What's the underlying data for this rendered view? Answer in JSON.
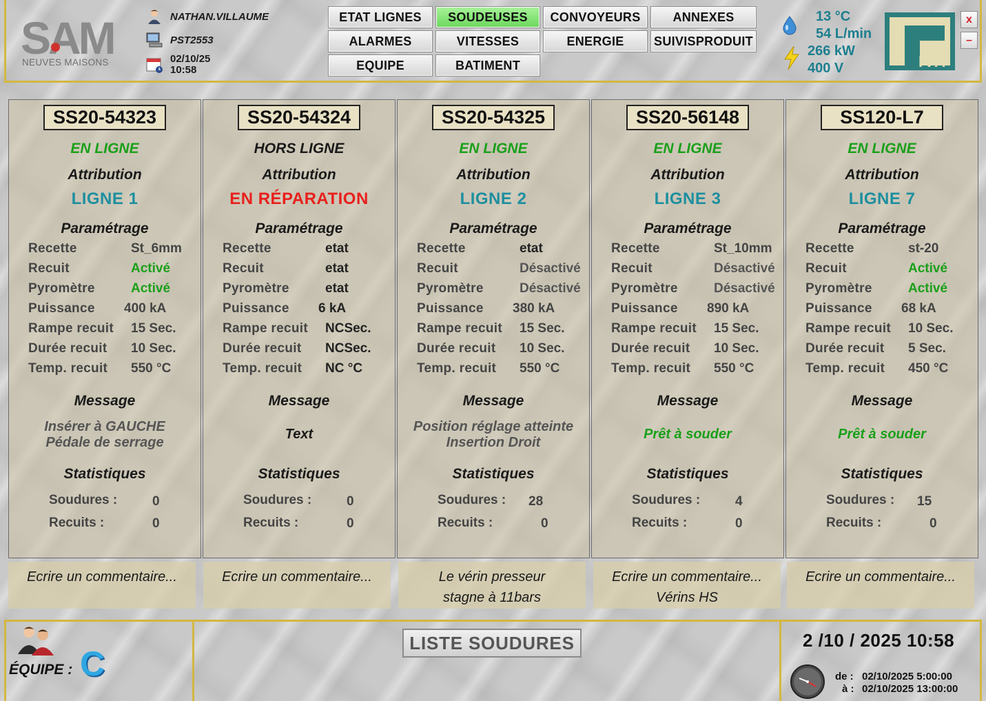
{
  "header": {
    "logo_text": "SAM",
    "logo_sub": "NEUVES MAISONS",
    "user": "NATHAN.VILLAUME",
    "station": "PST2553",
    "date": "02/10/25",
    "time": "10:58",
    "nav": [
      {
        "label": "ETAT LIGNES"
      },
      {
        "label": "SOUDEUSES",
        "active": true
      },
      {
        "label": "CONVOYEURS"
      },
      {
        "label": "ANNEXES"
      },
      {
        "label": "ALARMES"
      },
      {
        "label": "VITESSES"
      },
      {
        "label": "ENERGIE"
      },
      {
        "label": "SUIVISPRODUIT"
      },
      {
        "label": "EQUIPE"
      },
      {
        "label": "BATIMENT"
      }
    ],
    "stats": {
      "temperature": "13 °C",
      "flow": "54 L/min",
      "power": "266 kW",
      "voltage": "400 V"
    },
    "brand": "IVA",
    "close_label": "x",
    "minimize_label": "–"
  },
  "panels": [
    {
      "id": "SS20-54323",
      "status": "EN LIGNE",
      "status_color": "#1aa01a",
      "attribution_label": "Attribution",
      "line": "LIGNE 1",
      "line_color": "#1e8f9f",
      "param_label": "Paramétrage",
      "params": [
        {
          "label": "Recette",
          "value": "St_6mm",
          "color": "#444"
        },
        {
          "label": "Recuit",
          "value": "Activé",
          "color": "#1aa01a"
        },
        {
          "label": "Pyromètre",
          "value": "Activé",
          "color": "#1aa01a"
        },
        {
          "label": "Puissance",
          "value": "400 kA",
          "color": "#444"
        },
        {
          "label": "Rampe recuit",
          "value": "15 Sec.",
          "color": "#444"
        },
        {
          "label": "Durée recuit",
          "value": "10 Sec.",
          "color": "#444"
        },
        {
          "label": "Temp. recuit",
          "value": "550 °C",
          "color": "#444"
        }
      ],
      "message_label": "Message",
      "message": [
        "Insérer à GAUCHE",
        "Pédale de serrage"
      ],
      "message_color": "#555",
      "stats_label": "Statistiques",
      "soudures_label": "Soudures :",
      "soudures": "0",
      "recuits_label": "Recuits :",
      "recuits": "0",
      "comment": [
        "Ecrire un commentaire..."
      ]
    },
    {
      "id": "SS20-54324",
      "status": "HORS LIGNE",
      "status_color": "#1a1a1a",
      "attribution_label": "Attribution",
      "line": "EN RÉPARATION",
      "line_color": "#e8201c",
      "param_label": "Paramétrage",
      "params": [
        {
          "label": "Recette",
          "value": "etat",
          "color": "#222"
        },
        {
          "label": "Recuit",
          "value": "etat",
          "color": "#222"
        },
        {
          "label": "Pyromètre",
          "value": "etat",
          "color": "#222"
        },
        {
          "label": "Puissance",
          "value": "6 kA",
          "color": "#222"
        },
        {
          "label": "Rampe recuit",
          "value": "NCSec.",
          "color": "#222"
        },
        {
          "label": "Durée recuit",
          "value": "NCSec.",
          "color": "#222"
        },
        {
          "label": "Temp. recuit",
          "value": "NC  °C",
          "color": "#222"
        }
      ],
      "message_label": "Message",
      "message": [
        "Text"
      ],
      "message_color": "#1a1a1a",
      "stats_label": "Statistiques",
      "soudures_label": "Soudures :",
      "soudures": "0",
      "recuits_label": "Recuits :",
      "recuits": "0",
      "comment": [
        "Ecrire un commentaire..."
      ]
    },
    {
      "id": "SS20-54325",
      "status": "EN LIGNE",
      "status_color": "#1aa01a",
      "attribution_label": "Attribution",
      "line": "LIGNE 2",
      "line_color": "#1e8f9f",
      "param_label": "Paramétrage",
      "params": [
        {
          "label": "Recette",
          "value": "etat",
          "color": "#222"
        },
        {
          "label": "Recuit",
          "value": "Désactivé",
          "color": "#555"
        },
        {
          "label": "Pyromètre",
          "value": "Désactivé",
          "color": "#555"
        },
        {
          "label": "Puissance",
          "value": "380 kA",
          "color": "#444"
        },
        {
          "label": "Rampe recuit",
          "value": "15 Sec.",
          "color": "#444"
        },
        {
          "label": "Durée recuit",
          "value": "10 Sec.",
          "color": "#444"
        },
        {
          "label": "Temp. recuit",
          "value": "550 °C",
          "color": "#444"
        }
      ],
      "message_label": "Message",
      "message": [
        "Position réglage atteinte",
        "Insertion Droit"
      ],
      "message_color": "#555",
      "stats_label": "Statistiques",
      "soudures_label": "Soudures :",
      "soudures": "28",
      "recuits_label": "Recuits :",
      "recuits": "0",
      "comment": [
        "Le vérin presseur",
        "stagne à 11bars"
      ]
    },
    {
      "id": "SS20-56148",
      "status": "EN LIGNE",
      "status_color": "#1aa01a",
      "attribution_label": "Attribution",
      "line": "LIGNE 3",
      "line_color": "#1e8f9f",
      "param_label": "Paramétrage",
      "params": [
        {
          "label": "Recette",
          "value": "St_10mm",
          "color": "#444"
        },
        {
          "label": "Recuit",
          "value": "Désactivé",
          "color": "#555"
        },
        {
          "label": "Pyromètre",
          "value": "Désactivé",
          "color": "#555"
        },
        {
          "label": "Puissance",
          "value": "890 kA",
          "color": "#444"
        },
        {
          "label": "Rampe recuit",
          "value": "15 Sec.",
          "color": "#444"
        },
        {
          "label": "Durée recuit",
          "value": "10 Sec.",
          "color": "#444"
        },
        {
          "label": "Temp. recuit",
          "value": "550 °C",
          "color": "#444"
        }
      ],
      "message_label": "Message",
      "message": [
        "Prêt à souder"
      ],
      "message_color": "#1aa01a",
      "stats_label": "Statistiques",
      "soudures_label": "Soudures :",
      "soudures": "4",
      "recuits_label": "Recuits :",
      "recuits": "0",
      "comment": [
        "Ecrire un commentaire...",
        "Vérins HS"
      ]
    },
    {
      "id": "SS120-L7",
      "status": "EN LIGNE",
      "status_color": "#1aa01a",
      "attribution_label": "Attribution",
      "line": "LIGNE 7",
      "line_color": "#1e8f9f",
      "param_label": "Paramétrage",
      "params": [
        {
          "label": "Recette",
          "value": "st-20",
          "color": "#444"
        },
        {
          "label": "Recuit",
          "value": "Activé",
          "color": "#1aa01a"
        },
        {
          "label": "Pyromètre",
          "value": "Activé",
          "color": "#1aa01a"
        },
        {
          "label": "Puissance",
          "value": "68 kA",
          "color": "#444"
        },
        {
          "label": "Rampe recuit",
          "value": "10 Sec.",
          "color": "#444"
        },
        {
          "label": "Durée recuit",
          "value": "5   Sec.",
          "color": "#444"
        },
        {
          "label": "Temp. recuit",
          "value": "450 °C",
          "color": "#444"
        }
      ],
      "message_label": "Message",
      "message": [
        "Prêt à souder"
      ],
      "message_color": "#1aa01a",
      "stats_label": "Statistiques",
      "soudures_label": "Soudures :",
      "soudures": "15",
      "recuits_label": "Recuits :",
      "recuits": "0",
      "comment": [
        "Ecrire un commentaire..."
      ]
    }
  ],
  "footer": {
    "equipe_label": "ÉQUIPE :",
    "equipe_value": "C",
    "liste_button": "LISTE SOUDURES",
    "datetime": "2 /10 / 2025  10:58",
    "from_label": "de :",
    "from_value": "02/10/2025 5:00:00",
    "to_label": "à :",
    "to_value": "02/10/2025 13:00:00"
  }
}
